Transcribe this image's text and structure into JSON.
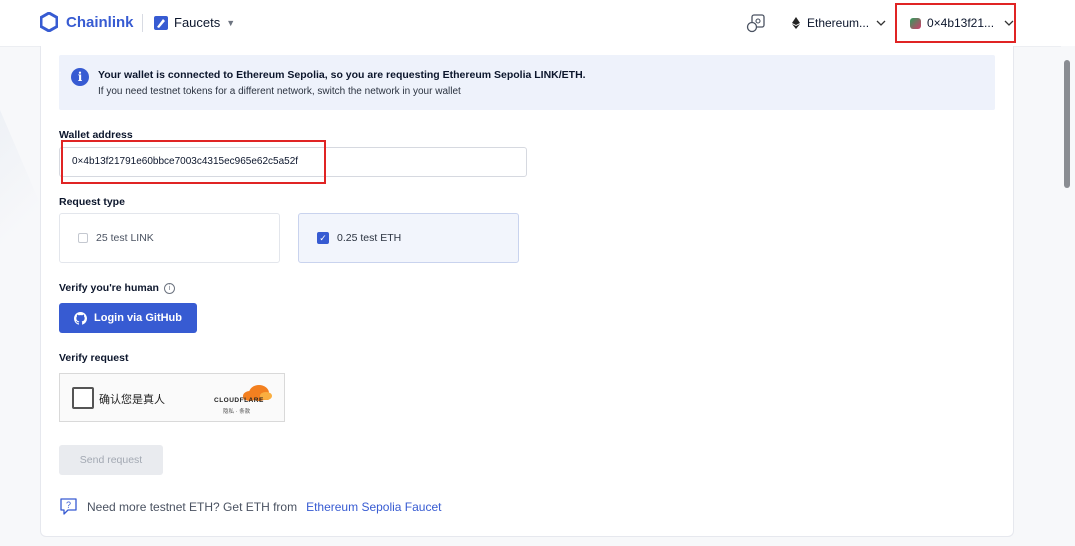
{
  "header": {
    "brand": "Chainlink",
    "product_menu": "Faucets",
    "network": "Ethereum...",
    "wallet": "0×4b13f21..."
  },
  "info": {
    "line1": "Your wallet is connected to Ethereum Sepolia, so you are requesting Ethereum Sepolia LINK/ETH.",
    "line2": "If you need testnet tokens for a different network, switch the network in your wallet"
  },
  "form": {
    "wallet_label": "Wallet address",
    "wallet_value": "0×4b13f21791e60bbce7003c4315ec965e62c5a52f",
    "request_type_label": "Request type",
    "options": [
      {
        "label": "25 test LINK",
        "checked": false
      },
      {
        "label": "0.25 test ETH",
        "checked": true
      }
    ],
    "verify_human_label": "Verify you're human",
    "github_button": "Login via GitHub",
    "verify_request_label": "Verify request",
    "captcha_text": "确认您是真人",
    "captcha_brand": "CLOUDFLARE",
    "captcha_links": "隐私 · 条款",
    "send_button": "Send request"
  },
  "footer": {
    "more_text": "Need more testnet ETH? Get ETH from",
    "more_link": "Ethereum Sepolia Faucet"
  },
  "colors": {
    "accent": "#375bd2",
    "highlight": "#e02424"
  },
  "icons": [
    "chainlink-logo-icon",
    "faucet-icon",
    "chevron-down-icon",
    "wallet-connect-icon",
    "ethereum-icon",
    "info-icon",
    "github-icon",
    "checkbox-checked-icon",
    "cloudflare-icon",
    "help-icon"
  ]
}
